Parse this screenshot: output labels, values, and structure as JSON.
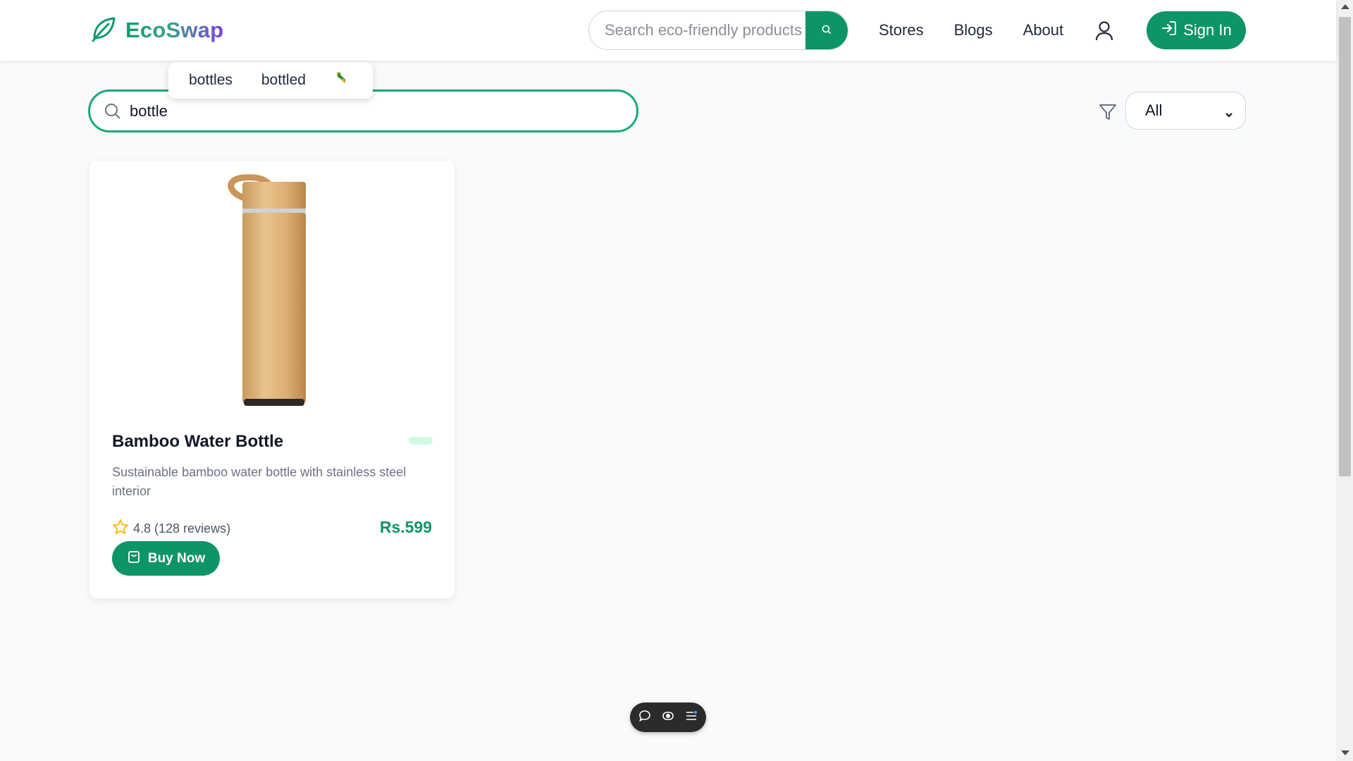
{
  "header": {
    "logo_text": "EcoSwap",
    "search": {
      "placeholder": "Search eco-friendly products",
      "value": ""
    },
    "nav": [
      "Stores",
      "Blogs",
      "About"
    ],
    "sign_in_label": "Sign In"
  },
  "suggestions": [
    "bottles",
    "bottled"
  ],
  "main_search": {
    "value": "bottle"
  },
  "filter": {
    "selected": "All"
  },
  "products": [
    {
      "title": "Bamboo Water Bottle",
      "description": "Sustainable bamboo water bottle with stainless steel interior",
      "rating": "4.8 (128 reviews)",
      "price": "Rs.599",
      "buy_label": "Buy Now"
    }
  ],
  "colors": {
    "brand_green": "#0e9566",
    "search_border": "#1aaa78",
    "logo_gradient_end": "#7b3fe0",
    "star": "#f5b800"
  },
  "icons": [
    "leaf-logo-icon",
    "search-icon",
    "user-icon",
    "sign-in-icon",
    "bottle-emoji-icon",
    "filter-icon",
    "chevron-down-icon",
    "star-icon",
    "shopping-bag-icon",
    "chat-icon",
    "eye-icon",
    "menu-icon"
  ]
}
